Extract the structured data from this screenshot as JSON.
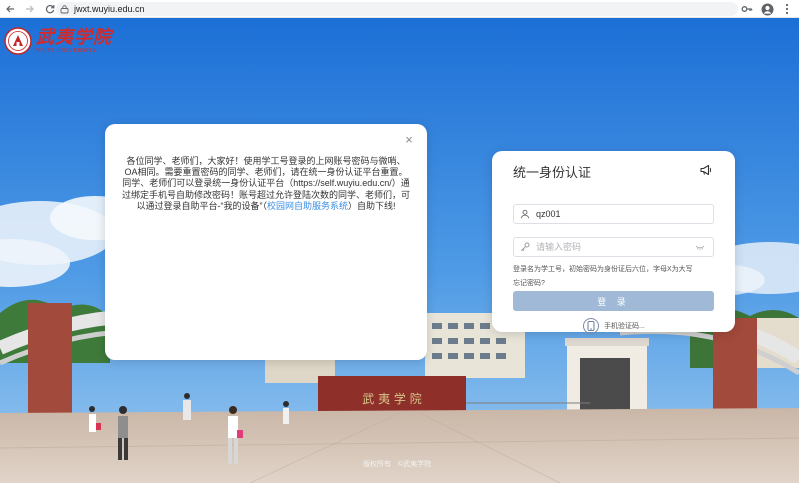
{
  "browser": {
    "url": "jwxt.wuyiu.edu.cn",
    "back_icon": "arrow-left-icon",
    "forward_icon": "arrow-right-icon",
    "reload_icon": "reload-icon"
  },
  "logo": {
    "name_cn": "武夷学院",
    "name_en": "WUYI UNIVERSITY"
  },
  "notice": {
    "text_before_link": "各位同学、老师们，大家好！使用学工号登录的上网账号密码与微哨、OA相同。需要重置密码的同学、老师们，请在统一身份认证平台重置。同学、老师们可以登录统一身份认证平台（https://self.wuyiu.edu.cn/）通过绑定手机号自助修改密码！账号超过允许登陆次数的同学、老师们，可以通过登录自助平台-“我的设备”（",
    "link_text": "校园网自助服务系统",
    "text_after_link": "）自助下线!",
    "close_label": "×"
  },
  "login": {
    "title": "统一身份认证",
    "username_value": "qz001",
    "password_placeholder": "请输入密码",
    "hint": "登录名为学工号，初始密码为身份证后六位，字母X为大写",
    "forgot": "忘记密码?",
    "submit": "登 录",
    "sms_label": "手机验证码..."
  },
  "footer": {
    "copyright": "版权所有　©武夷学院"
  },
  "colors": {
    "sky_top": "#1c6fd6",
    "sky_bottom": "#7fb8ec",
    "brand_red": "#d22a2a",
    "link_blue": "#3a8ee6",
    "button_blue": "#a0b9d6"
  }
}
